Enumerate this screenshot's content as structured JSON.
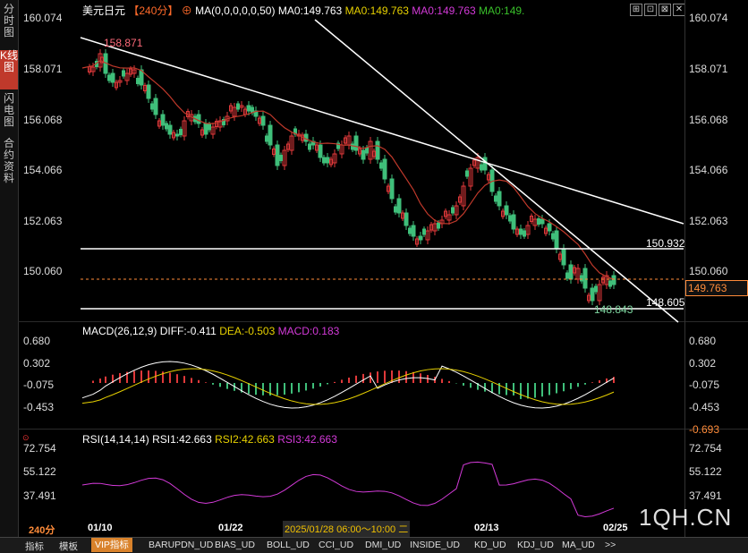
{
  "sidebar": {
    "tabs": [
      {
        "label": "分时图",
        "active": false
      },
      {
        "label": "K线图",
        "active": true
      },
      {
        "label": "闪电图",
        "active": false
      },
      {
        "label": "合约资料",
        "active": false
      }
    ]
  },
  "header": {
    "symbol": "美元日元",
    "period": "【240分】",
    "ma_legend": "MA(0,0,0,0,0,50)",
    "ma_values": [
      "MA0:149.763",
      "MA0:149.763",
      "MA0:149.763",
      "MA0:149."
    ],
    "ma_colors": [
      "#ffffff",
      "#e6d000",
      "#d33ad8",
      "#39c02a"
    ],
    "accent": "#ff6a2a"
  },
  "main_chart": {
    "y_ticks": [
      "160.074",
      "158.071",
      "156.068",
      "154.066",
      "152.063",
      "150.060"
    ],
    "high_label": "158.871",
    "low_label": "148.843",
    "line_label_1": "150.932",
    "line_label_2": "148.605",
    "current_price": "149.763"
  },
  "macd": {
    "title": "MACD(26,12,9)",
    "diff": "DIFF:-0.411",
    "dea": "DEA:-0.503",
    "macd": "MACD:0.183",
    "y_ticks": [
      "0.680",
      "0.302",
      "-0.075",
      "-0.453"
    ],
    "current": "-0.693"
  },
  "rsi": {
    "title": "RSI(14,14,14)",
    "rsi1": "RSI1:42.663",
    "rsi2": "RSI2:42.663",
    "rsi3": "RSI3:42.663",
    "y_ticks": [
      "72.754",
      "55.122",
      "37.491"
    ]
  },
  "x_axis": {
    "period": "240分",
    "dates": [
      "01/10",
      "01/22",
      "02/13",
      "02/25"
    ],
    "crosshair_time": "2025/01/28 06:00～10:00 二"
  },
  "watermark": "1QH.CN",
  "toolbar": {
    "items": [
      "指标",
      "模板",
      "VIP指标",
      "BARUPDN_UD",
      "BIAS_UD",
      "BOLL_UD",
      "CCI_UD",
      "DMI_UD",
      "INSIDE_UD",
      "KD_UD",
      "KDJ_UD",
      "MA_UD"
    ],
    "more": ">>"
  },
  "colors": {
    "up": "#e0393a",
    "down": "#3fbf7a",
    "ma50": "#c0392b",
    "diff": "#ffffff",
    "dea": "#e6d000",
    "rsi": "#d33ad8",
    "trend": "#ffffff",
    "price_label": "#ff8c3a"
  }
}
